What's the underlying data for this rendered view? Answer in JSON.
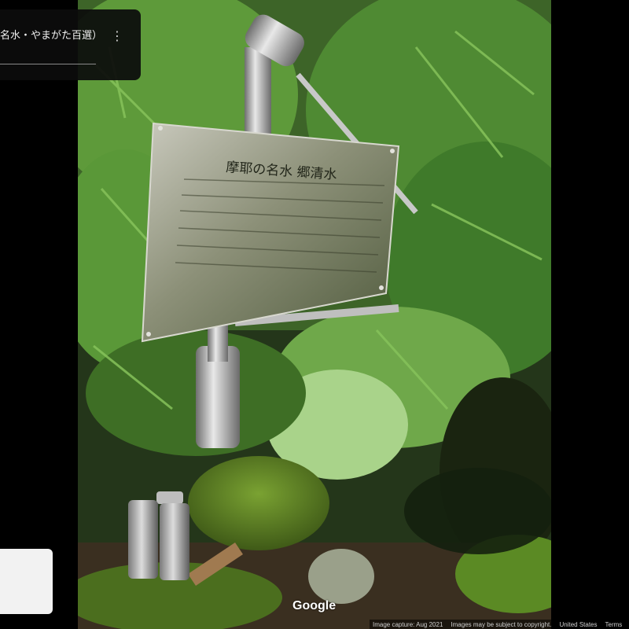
{
  "title_card": {
    "title": "名水・やまがた百選）",
    "menu_icon": "more-vertical-icon"
  },
  "photo": {
    "sign_heading": "摩耶の名水 郷清水"
  },
  "google_logo": "Google",
  "attribution": {
    "image_capture": "Image capture: Aug 2021",
    "copyright": "Images may be subject to copyright.",
    "region": "United States",
    "terms": "Terms"
  }
}
